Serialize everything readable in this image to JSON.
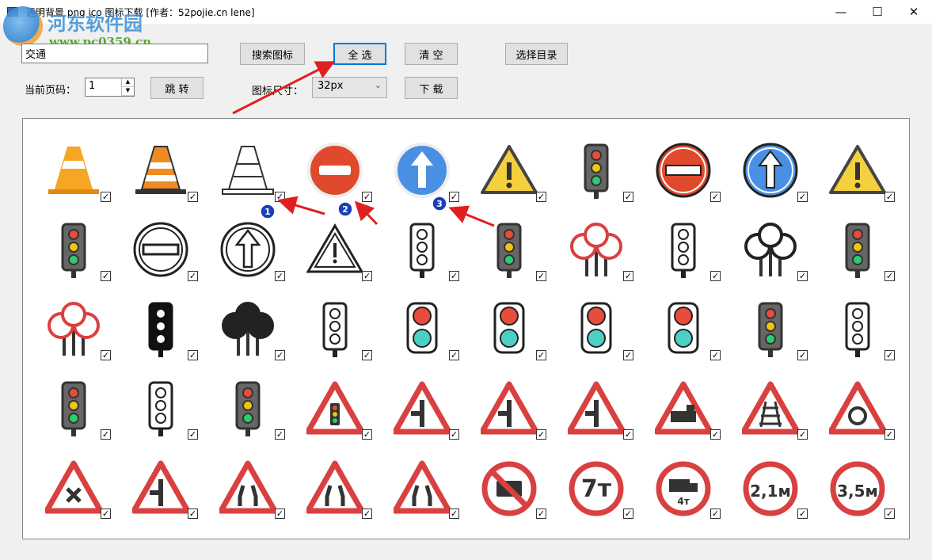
{
  "window": {
    "title": "透明背景 png ico 图标下载  [作者：52pojie.cn lene]",
    "minimize": "—",
    "maximize": "☐",
    "close": "✕"
  },
  "watermark": {
    "name": "河东软件园",
    "url": "www.pc0359.cn"
  },
  "search": {
    "value": "交通",
    "button": "搜索图标"
  },
  "toolbar": {
    "select_all": "全 选",
    "clear": "清 空",
    "choose_dir": "选择目录",
    "download": "下 载"
  },
  "paging": {
    "label": "当前页码：",
    "value": "1",
    "jump": "跳 转"
  },
  "size": {
    "label": "图标尺寸：",
    "value": "32px"
  },
  "annotations": [
    "1",
    "2",
    "3"
  ],
  "colors": {
    "accent": "#0078d7",
    "arrow": "#e02020",
    "badge": "#1a3fb8",
    "sign_red": "#d94040"
  },
  "icons": [
    {
      "kind": "cone",
      "checked": true
    },
    {
      "kind": "cone-striped",
      "checked": true
    },
    {
      "kind": "cone-outline",
      "checked": true
    },
    {
      "kind": "no-entry-3d",
      "checked": true
    },
    {
      "kind": "ahead-3d",
      "checked": true
    },
    {
      "kind": "warning",
      "checked": true
    },
    {
      "kind": "traffic-light-color",
      "checked": true
    },
    {
      "kind": "no-entry",
      "checked": true
    },
    {
      "kind": "ahead",
      "checked": true
    },
    {
      "kind": "warning",
      "checked": true
    },
    {
      "kind": "traffic-light-color",
      "checked": true
    },
    {
      "kind": "no-entry-outline",
      "checked": true
    },
    {
      "kind": "ahead-outline",
      "checked": true
    },
    {
      "kind": "warning-outline",
      "checked": true
    },
    {
      "kind": "traffic-light-outline",
      "checked": true
    },
    {
      "kind": "traffic-light-color",
      "checked": true
    },
    {
      "kind": "road-signs",
      "checked": true
    },
    {
      "kind": "traffic-light-outline",
      "checked": true
    },
    {
      "kind": "road-signs-outline",
      "checked": true
    },
    {
      "kind": "traffic-light-color",
      "checked": true
    },
    {
      "kind": "road-signs",
      "checked": true
    },
    {
      "kind": "traffic-light-black",
      "checked": true
    },
    {
      "kind": "road-signs-black",
      "checked": true
    },
    {
      "kind": "traffic-light-outline",
      "checked": true
    },
    {
      "kind": "pedestrian-light",
      "checked": true
    },
    {
      "kind": "pedestrian-light",
      "checked": true
    },
    {
      "kind": "pedestrian-light",
      "checked": true
    },
    {
      "kind": "pedestrian-light",
      "checked": true
    },
    {
      "kind": "traffic-light-color",
      "checked": true
    },
    {
      "kind": "traffic-light-outline",
      "checked": true
    },
    {
      "kind": "traffic-light-color",
      "checked": true
    },
    {
      "kind": "traffic-light-outline",
      "checked": true
    },
    {
      "kind": "traffic-light-color",
      "checked": true
    },
    {
      "kind": "triangle-traffic-light",
      "checked": true
    },
    {
      "kind": "triangle-junction",
      "checked": true
    },
    {
      "kind": "triangle-junction",
      "checked": true
    },
    {
      "kind": "triangle-junction",
      "checked": true
    },
    {
      "kind": "triangle-train",
      "checked": true
    },
    {
      "kind": "triangle-rail",
      "checked": true
    },
    {
      "kind": "triangle-roundabout",
      "checked": true
    },
    {
      "kind": "triangle-cross",
      "checked": true
    },
    {
      "kind": "triangle-junction",
      "checked": true
    },
    {
      "kind": "triangle-narrow",
      "checked": true
    },
    {
      "kind": "triangle-narrow",
      "checked": true
    },
    {
      "kind": "triangle-narrow",
      "checked": true
    },
    {
      "kind": "no-card",
      "checked": true
    },
    {
      "kind": "circle-text",
      "text": "7т",
      "checked": true
    },
    {
      "kind": "circle-truck",
      "text": "4т",
      "checked": true
    },
    {
      "kind": "circle-text",
      "text": "2,1м",
      "checked": true
    },
    {
      "kind": "circle-text",
      "text": "3,5м",
      "checked": true
    }
  ]
}
